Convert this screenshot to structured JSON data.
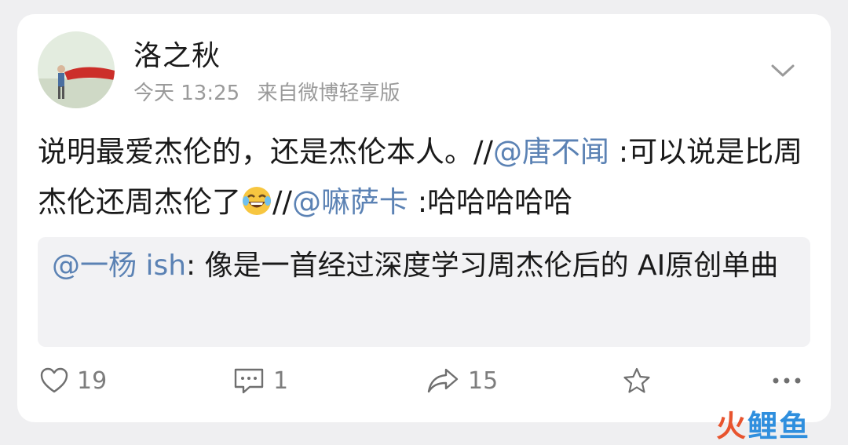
{
  "post": {
    "username": "洛之秋",
    "time": "今天 13:25",
    "source": "来自微博轻享版",
    "content": {
      "part1": "说明最爱杰伦的，还是杰伦本人。//",
      "mention1": "@唐不闻",
      "part2": " :可以说是比周杰伦还周杰伦了",
      "emoji": "laugh-cry",
      "part3": "//",
      "mention2": "@嘛萨卡",
      "part4": " :哈哈哈哈哈"
    },
    "quote": {
      "mention": "@一杨 ish",
      "text": ": 像是一首经过深度学习周杰伦后的 AI原创单曲"
    }
  },
  "actions": {
    "likes": "19",
    "comments": "1",
    "reposts": "15"
  },
  "watermark": {
    "part1": "火",
    "part2": "鲤鱼"
  },
  "colors": {
    "mention": "#5b82b4",
    "meta": "#9a9a9a",
    "quote_bg": "#f2f2f4"
  }
}
